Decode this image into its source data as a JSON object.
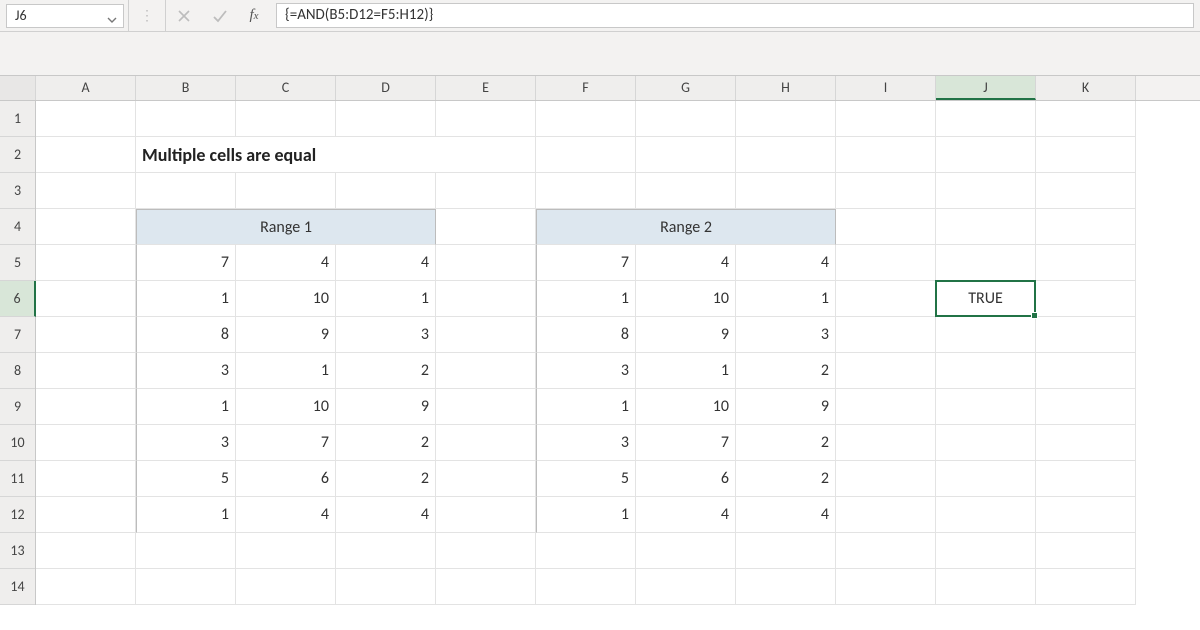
{
  "formula_bar": {
    "cell_ref": "J6",
    "formula": "{=AND(B5:D12=F5:H12)}"
  },
  "columns": [
    "A",
    "B",
    "C",
    "D",
    "E",
    "F",
    "G",
    "H",
    "I",
    "J",
    "K"
  ],
  "rows": [
    "1",
    "2",
    "3",
    "4",
    "5",
    "6",
    "7",
    "8",
    "9",
    "10",
    "11",
    "12",
    "13",
    "14"
  ],
  "selected_col_index": 9,
  "selected_row_index": 5,
  "title": "Multiple cells are equal",
  "range1_label": "Range 1",
  "range2_label": "Range 2",
  "range1": [
    [
      7,
      4,
      4
    ],
    [
      1,
      10,
      1
    ],
    [
      8,
      9,
      3
    ],
    [
      3,
      1,
      2
    ],
    [
      1,
      10,
      9
    ],
    [
      3,
      7,
      2
    ],
    [
      5,
      6,
      2
    ],
    [
      1,
      4,
      4
    ]
  ],
  "range2": [
    [
      7,
      4,
      4
    ],
    [
      1,
      10,
      1
    ],
    [
      8,
      9,
      3
    ],
    [
      3,
      1,
      2
    ],
    [
      1,
      10,
      9
    ],
    [
      3,
      7,
      2
    ],
    [
      5,
      6,
      2
    ],
    [
      1,
      4,
      4
    ]
  ],
  "result_value": "TRUE",
  "colors": {
    "excel_green": "#217346",
    "header_fill": "#dde7ef"
  },
  "chart_data": {
    "type": "table",
    "title": "Multiple cells are equal",
    "tables": [
      {
        "name": "Range 1",
        "columns": [
          "B",
          "C",
          "D"
        ],
        "rows": [
          [
            7,
            4,
            4
          ],
          [
            1,
            10,
            1
          ],
          [
            8,
            9,
            3
          ],
          [
            3,
            1,
            2
          ],
          [
            1,
            10,
            9
          ],
          [
            3,
            7,
            2
          ],
          [
            5,
            6,
            2
          ],
          [
            1,
            4,
            4
          ]
        ]
      },
      {
        "name": "Range 2",
        "columns": [
          "F",
          "G",
          "H"
        ],
        "rows": [
          [
            7,
            4,
            4
          ],
          [
            1,
            10,
            1
          ],
          [
            8,
            9,
            3
          ],
          [
            3,
            1,
            2
          ],
          [
            1,
            10,
            9
          ],
          [
            3,
            7,
            2
          ],
          [
            5,
            6,
            2
          ],
          [
            1,
            4,
            4
          ]
        ]
      }
    ],
    "formula": "{=AND(B5:D12=F5:H12)}",
    "result_cell": "J6",
    "result": "TRUE"
  }
}
